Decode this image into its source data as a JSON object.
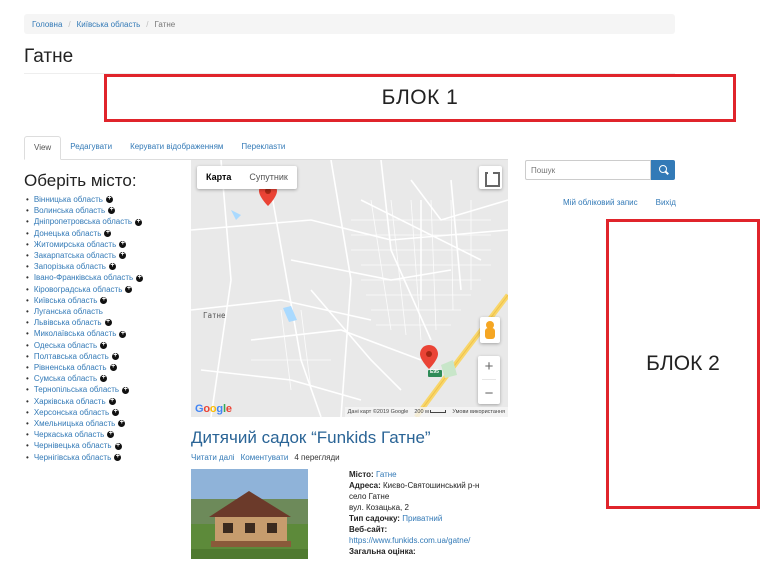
{
  "breadcrumb": {
    "home": "Головна",
    "region": "Київська область",
    "current": "Гатне"
  },
  "page_title": "Гатне",
  "block1_label": "БЛОК 1",
  "block2_label": "БЛОК 2",
  "tabs": [
    {
      "label": "View",
      "active": true
    },
    {
      "label": "Редагувати",
      "active": false
    },
    {
      "label": "Керувати відображенням",
      "active": false
    },
    {
      "label": "Переклasти",
      "active": false
    }
  ],
  "sidebar": {
    "heading": "Оберіть місто:",
    "regions": [
      "Вінницька область",
      "Волинська область",
      "Дніпропетровська область",
      "Донецька область",
      "Житомирська область",
      "Закарпатська область",
      "Запорізька область",
      "Івано-Франківська область",
      "Кіровоградська область",
      "Київська область",
      "Луганська область",
      "Львівська область",
      "Миколаївська область",
      "Одеська область",
      "Полтавська область",
      "Рівненська область",
      "Сумська область",
      "Тернопільська область",
      "Харківська область",
      "Херсонська область",
      "Хмельницька область",
      "Черкаська область",
      "Чернівецька область",
      "Чернігівська область"
    ]
  },
  "map": {
    "type_map": "Карта",
    "type_satellite": "Супутник",
    "town_label": "Гатне",
    "road_badge": "E95",
    "google": "Google",
    "attribution": "Дані карт ©2019 Google",
    "scale": "200 м",
    "terms": "Умови використання"
  },
  "search": {
    "placeholder": "Пошук"
  },
  "user_links": {
    "account": "Мій обліковий запис",
    "logout": "Вихід"
  },
  "article": {
    "title": "Дитячий садок “Funkids Гатне”",
    "read_more": "Читати далі",
    "comment": "Коментувати",
    "views": "4 перегляди",
    "city_label": "Місто:",
    "city_value": "Гатне",
    "address_label": "Адреса:",
    "address_line1": "Києво-Святошинський р-н",
    "address_line2": "село Гатне",
    "address_line3": "вул. Козацька, 2",
    "type_label": "Тип садочку:",
    "type_value": "Приватний",
    "website_label": "Веб-сайт:",
    "website_value": "https://www.funkids.com.ua/gatne/",
    "rating_label": "Загальна оцінка:"
  }
}
